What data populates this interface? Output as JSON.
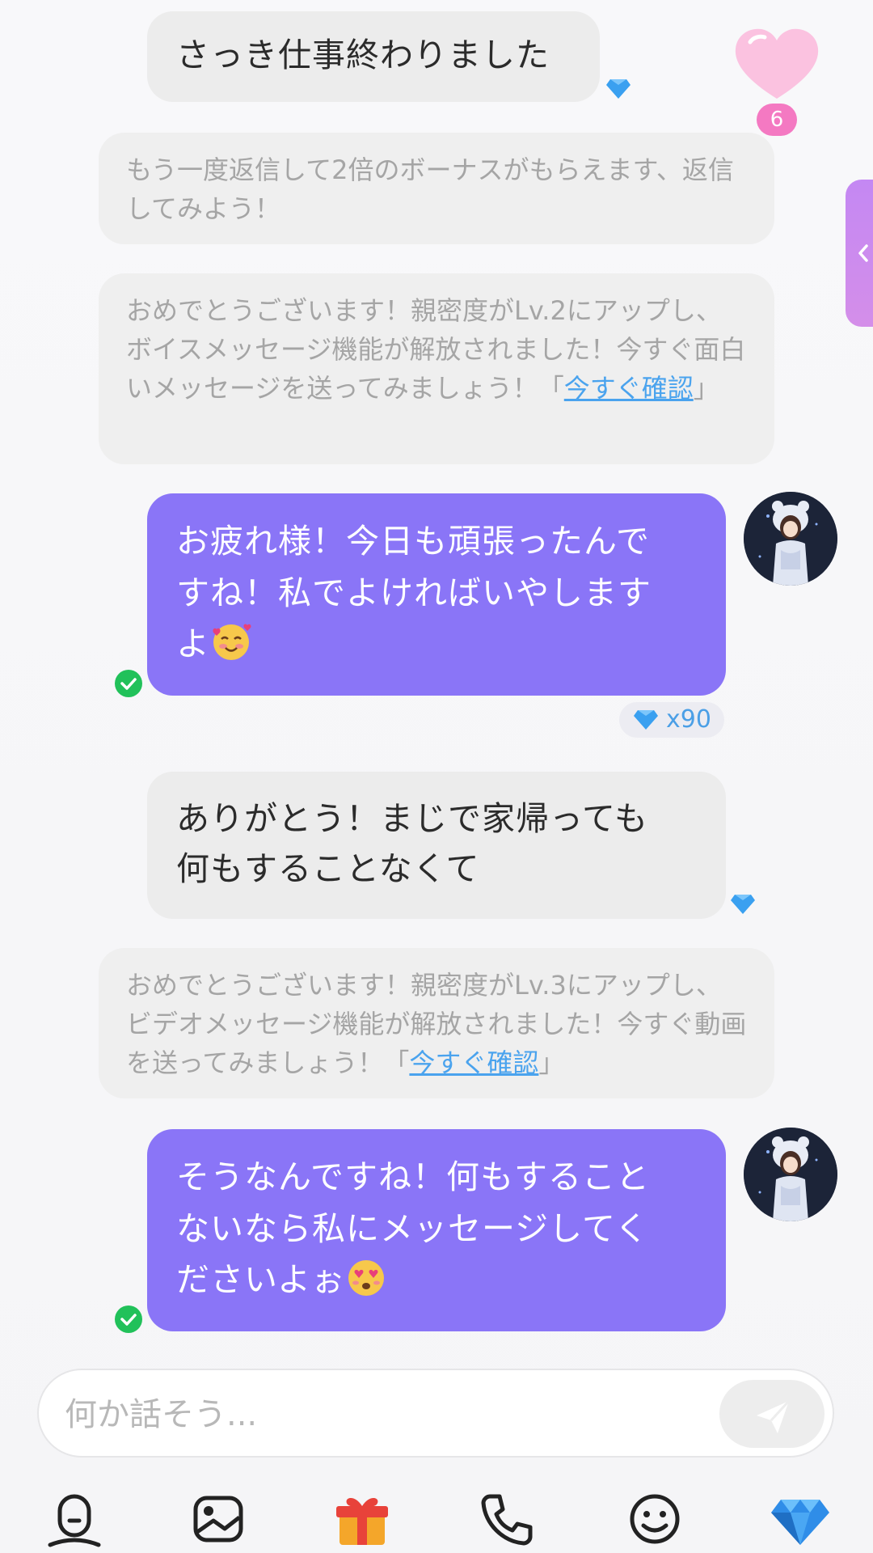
{
  "messages": {
    "m1": "さっき仕事終わりました",
    "s1": "もう一度返信して2倍のボーナスがもらえます、返信してみよう！",
    "s2_text": "おめでとうございます！親密度がLv.2にアップし、ボイスメッセージ機能が解放されました！今すぐ面白いメッセージを送ってみましょう！「",
    "s2_link": "今すぐ確認",
    "s2_end": "」",
    "m2_line1": "お疲れ様！今日も頑張ったんで",
    "m2_line2": "すね！私でよければいやします",
    "m2_line3": "よ",
    "m3_line1": "ありがとう！まじで家帰っても",
    "m3_line2": "何もすることなくて",
    "s3_text": "おめでとうございます！親密度がLv.3にアップし、ビデオメッセージ機能が解放されました！今すぐ動画を送ってみましょう！「",
    "s3_link": "今すぐ確認",
    "s3_end": "」",
    "m4_line1": "そうなんですね！何もすること",
    "m4_line2": "ないなら私にメッセージしてく",
    "m4_line3": "ださいよぉ"
  },
  "cost_label": "x90",
  "heart_count": "6",
  "input": {
    "placeholder": "何か話そう..."
  },
  "toolbar": {
    "icons": [
      "voice-icon",
      "image-icon",
      "gift-icon",
      "phone-icon",
      "emoji-icon",
      "diamond-icon"
    ]
  },
  "colors": {
    "accent": "#8a75f7",
    "link": "#4aa3ee",
    "diamond": "#3aa0f0",
    "status_green": "#21c15a"
  }
}
